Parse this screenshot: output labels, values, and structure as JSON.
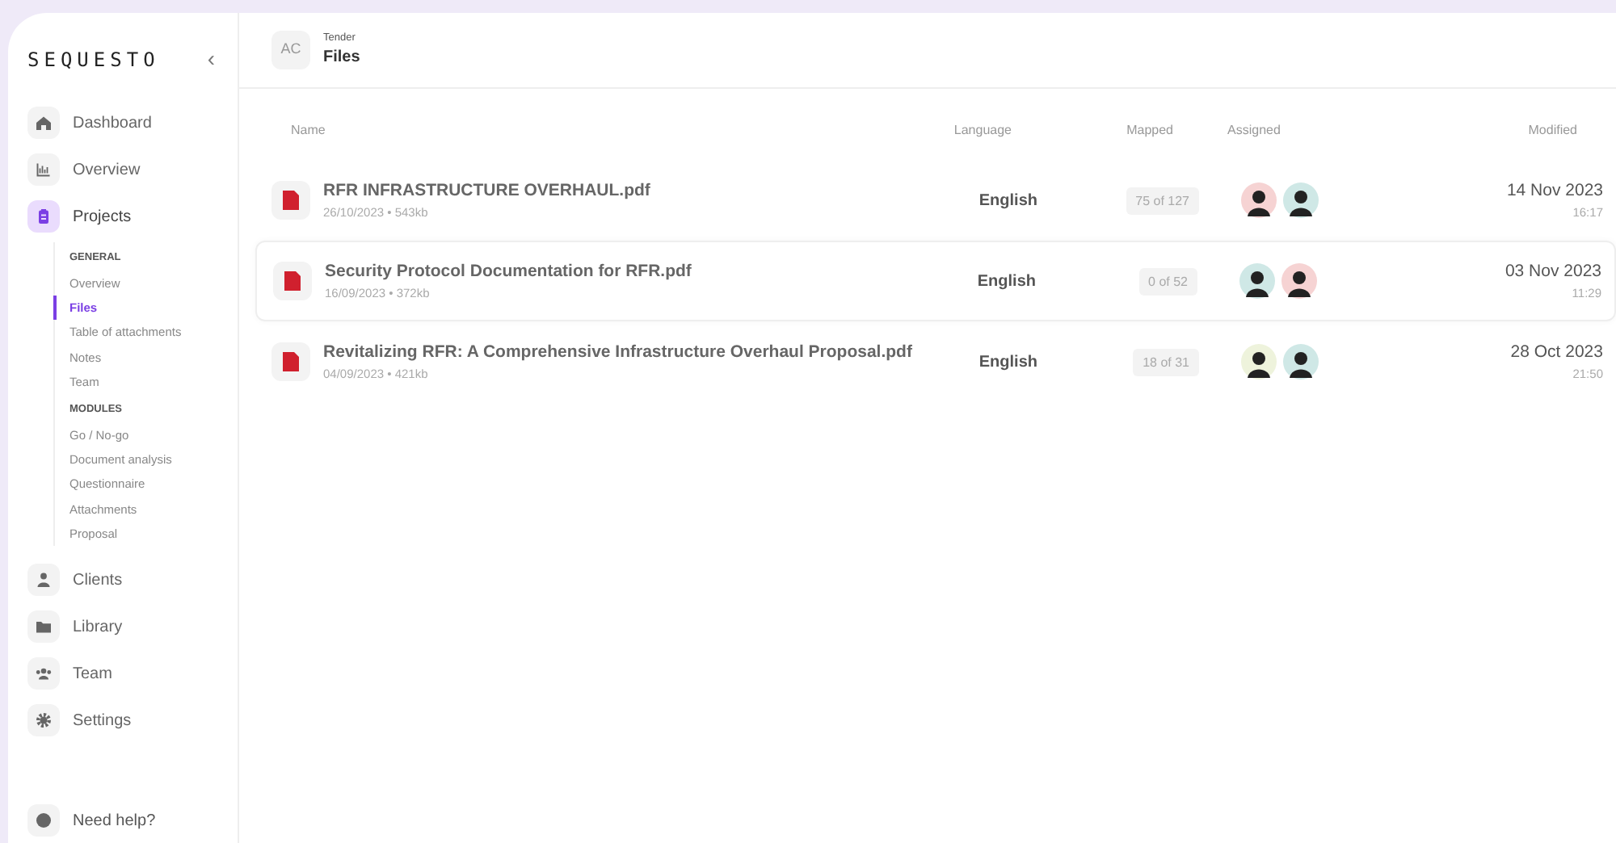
{
  "sidebar": {
    "logo": "SEQUESTO",
    "collapse": "‹",
    "items": [
      {
        "label": "Dashboard",
        "kind": "home",
        "selected": false
      },
      {
        "label": "Overview",
        "kind": "chart",
        "selected": false
      },
      {
        "label": "Projects",
        "kind": "clipboard",
        "selected": true,
        "children": [
          {
            "kind": "heading",
            "label": "GENERAL"
          },
          {
            "kind": "link",
            "label": "Overview",
            "selected": false
          },
          {
            "kind": "link",
            "label": "Files",
            "selected": true
          },
          {
            "kind": "link",
            "label": "Table of attachments",
            "selected": false
          },
          {
            "kind": "link",
            "label": "Notes",
            "selected": false
          },
          {
            "kind": "link",
            "label": "Team",
            "selected": false
          },
          {
            "kind": "heading",
            "label": "MODULES"
          },
          {
            "kind": "link",
            "label": "Go / No-go",
            "selected": false
          },
          {
            "kind": "link",
            "label": "Document analysis",
            "selected": false
          },
          {
            "kind": "link",
            "label": "Questionnaire",
            "selected": false
          },
          {
            "kind": "link",
            "label": "Attachments",
            "selected": false
          },
          {
            "kind": "link",
            "label": "Proposal",
            "selected": false
          }
        ]
      },
      {
        "label": "Clients",
        "kind": "user",
        "selected": false
      },
      {
        "label": "Library",
        "kind": "folder",
        "selected": false
      },
      {
        "label": "Team",
        "kind": "users",
        "selected": false
      },
      {
        "label": "Settings",
        "kind": "gear",
        "selected": false
      }
    ],
    "help": "Need help?"
  },
  "header": {
    "avatar": "AC",
    "subtitle": "Tender",
    "title": "Files"
  },
  "table": {
    "columns": [
      "Name",
      "Language",
      "Mapped",
      "Assigned",
      "Modified"
    ],
    "rows": [
      {
        "name": "RFR INFRASTRUCTURE OVERHAUL.pdf",
        "meta": "26/10/2023 • 543kb",
        "language": "English",
        "mapped": "75 of 127",
        "assigned": [
          {
            "color": "#f6d3d3"
          },
          {
            "color": "#cfe8e6"
          }
        ],
        "date": "14 Nov 2023",
        "time": "16:17",
        "selected": false
      },
      {
        "name": "Security Protocol Documentation for RFR.pdf",
        "meta": "16/09/2023 • 372kb",
        "language": "English",
        "mapped": "0 of 52",
        "assigned": [
          {
            "color": "#cfe8e6"
          },
          {
            "color": "#f6d3d3"
          }
        ],
        "date": "03 Nov 2023",
        "time": "11:29",
        "selected": true
      },
      {
        "name": "Revitalizing RFR: A Comprehensive Infrastructure Overhaul Proposal.pdf",
        "meta": "04/09/2023 • 421kb",
        "language": "English",
        "mapped": "18 of 31",
        "assigned": [
          {
            "color": "#eef3dc"
          },
          {
            "color": "#cfe8e6"
          }
        ],
        "date": "28 Oct 2023",
        "time": "21:50",
        "selected": false
      }
    ]
  }
}
